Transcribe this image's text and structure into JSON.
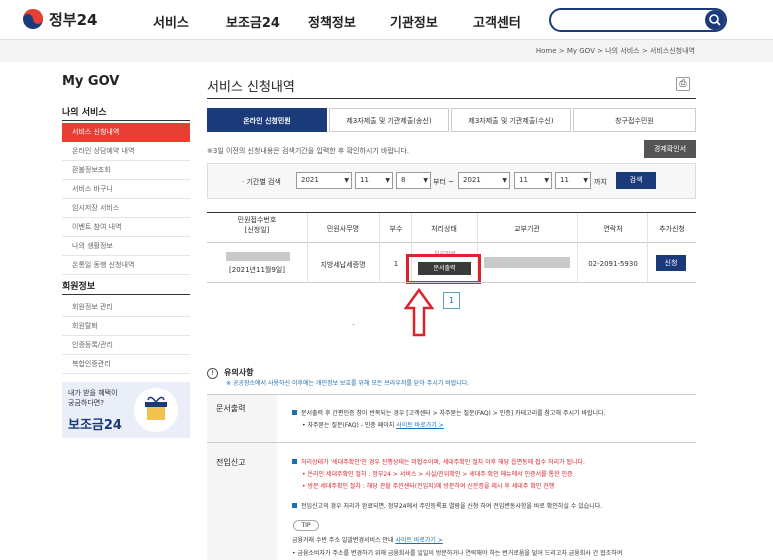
{
  "header": {
    "logo_text": "정부24",
    "nav": [
      "서비스",
      "보조금24",
      "정책정보",
      "기관정보",
      "고객센터"
    ],
    "search_placeholder": ""
  },
  "breadcrumb": "Home > My GOV > 나의 서비스 > 서비스신청내역",
  "sidebar": {
    "title": "My GOV",
    "section1": "나의 서비스",
    "items1": [
      "서비스 신청내역",
      "온라인 상담예약 내역",
      "환불정보조회",
      "서비스 바구니",
      "임시저장 서비스",
      "이벤트 참여 내역",
      "나의 생활정보",
      "온통일 동행 신청내역"
    ],
    "section2": "회원정보",
    "items2": [
      "회원정보 관리",
      "회원탈퇴",
      "인증등록/관리",
      "복합인증관리"
    ],
    "banner_text": "내가 받을 혜택이\n궁금하다면?",
    "banner_brand": "보조금24"
  },
  "page": {
    "title": "서비스 신청내역",
    "tabs": [
      "온라인 신청민원",
      "제3자제출 및 기관제출(송신)",
      "제3자제출 및 기관제출(수신)",
      "창구접수민원"
    ],
    "notice": "※3일 이전의 신청내용은 검색기간을 입력한 후 확인하시기 바랍니다.",
    "certify_btn": "경제확인서",
    "period_label": "· 기간별 검색",
    "from": {
      "year": "2021",
      "month": "11",
      "day": "8"
    },
    "to": {
      "year": "2021",
      "month": "11",
      "day": "11"
    },
    "from_text": "부터 ~",
    "to_text": "까지",
    "search_btn": "검색"
  },
  "table": {
    "headers": [
      "민원접수번호\n[신청일]",
      "민원사무명",
      "부수",
      "처리상태",
      "교부기관",
      "연락처",
      "추가신청"
    ],
    "row": {
      "date": "[2021년11월9일]",
      "office_name": "지방세납세증명",
      "copies": "1",
      "status": "처리완료",
      "doc_btn": "문서출력",
      "phone": "02-2091-5930",
      "apply_btn": "신청"
    }
  },
  "pagination": {
    "current": "1"
  },
  "dot": ".",
  "caution": {
    "title": "유의사항",
    "desc": "※ 공공장소에서 사용하신 이후에는 개인정보 보호를 위해 모든 브라우저를 닫아 주시기 바랍니다."
  },
  "doc_section": {
    "label": "문서출력",
    "line1": "문서출력 후 간편인증 창이 반복되는 경우 [고객센터 > 자주묻는 질문(FAQ) > 인증] 카테고리를 참고해 주시기 바랍니다.",
    "line2": "자주묻는 질문(FAQ) - 인증 페이지",
    "line2_link": "사이트 바로가기 >"
  },
  "move_section": {
    "label": "전입신고",
    "line1": "처리상태가 '세대주확인'인 경우 진행상태는 미접수이며, 세대주확인 절차 이후 해당 읍면동에 접수 처리가 됩니다.",
    "line2": "온라인 세대주확인 절차 : 정부24 > 서비스 > 사실/진위확인 > 세대주 확인 메뉴에서 인증서를 통한 인증",
    "line3": "방문 세대주확인 절차 : 해당 관할 주민센터(전입지)에 방문하여 신분증을 제시 후 세대주 확인 진행",
    "line4": "전입신고의 경우 처리가 완료되면, 정부24에서 주민등록표 열람을 신청 하여 전입변동사항을 바로 확인하실 수 있습니다.",
    "tip": "TIP",
    "line5": "금융거래 수반 주소 일괄변경서비스 안내",
    "line5_link": "사이트 바로가기 >",
    "line6": "금융소비자가 주소를 변경하기 위해 금융회사를 일일이 방문하거나 연락해야 하는 번거로움을 덜어 드리고자 금융회사 간 협조하여"
  }
}
